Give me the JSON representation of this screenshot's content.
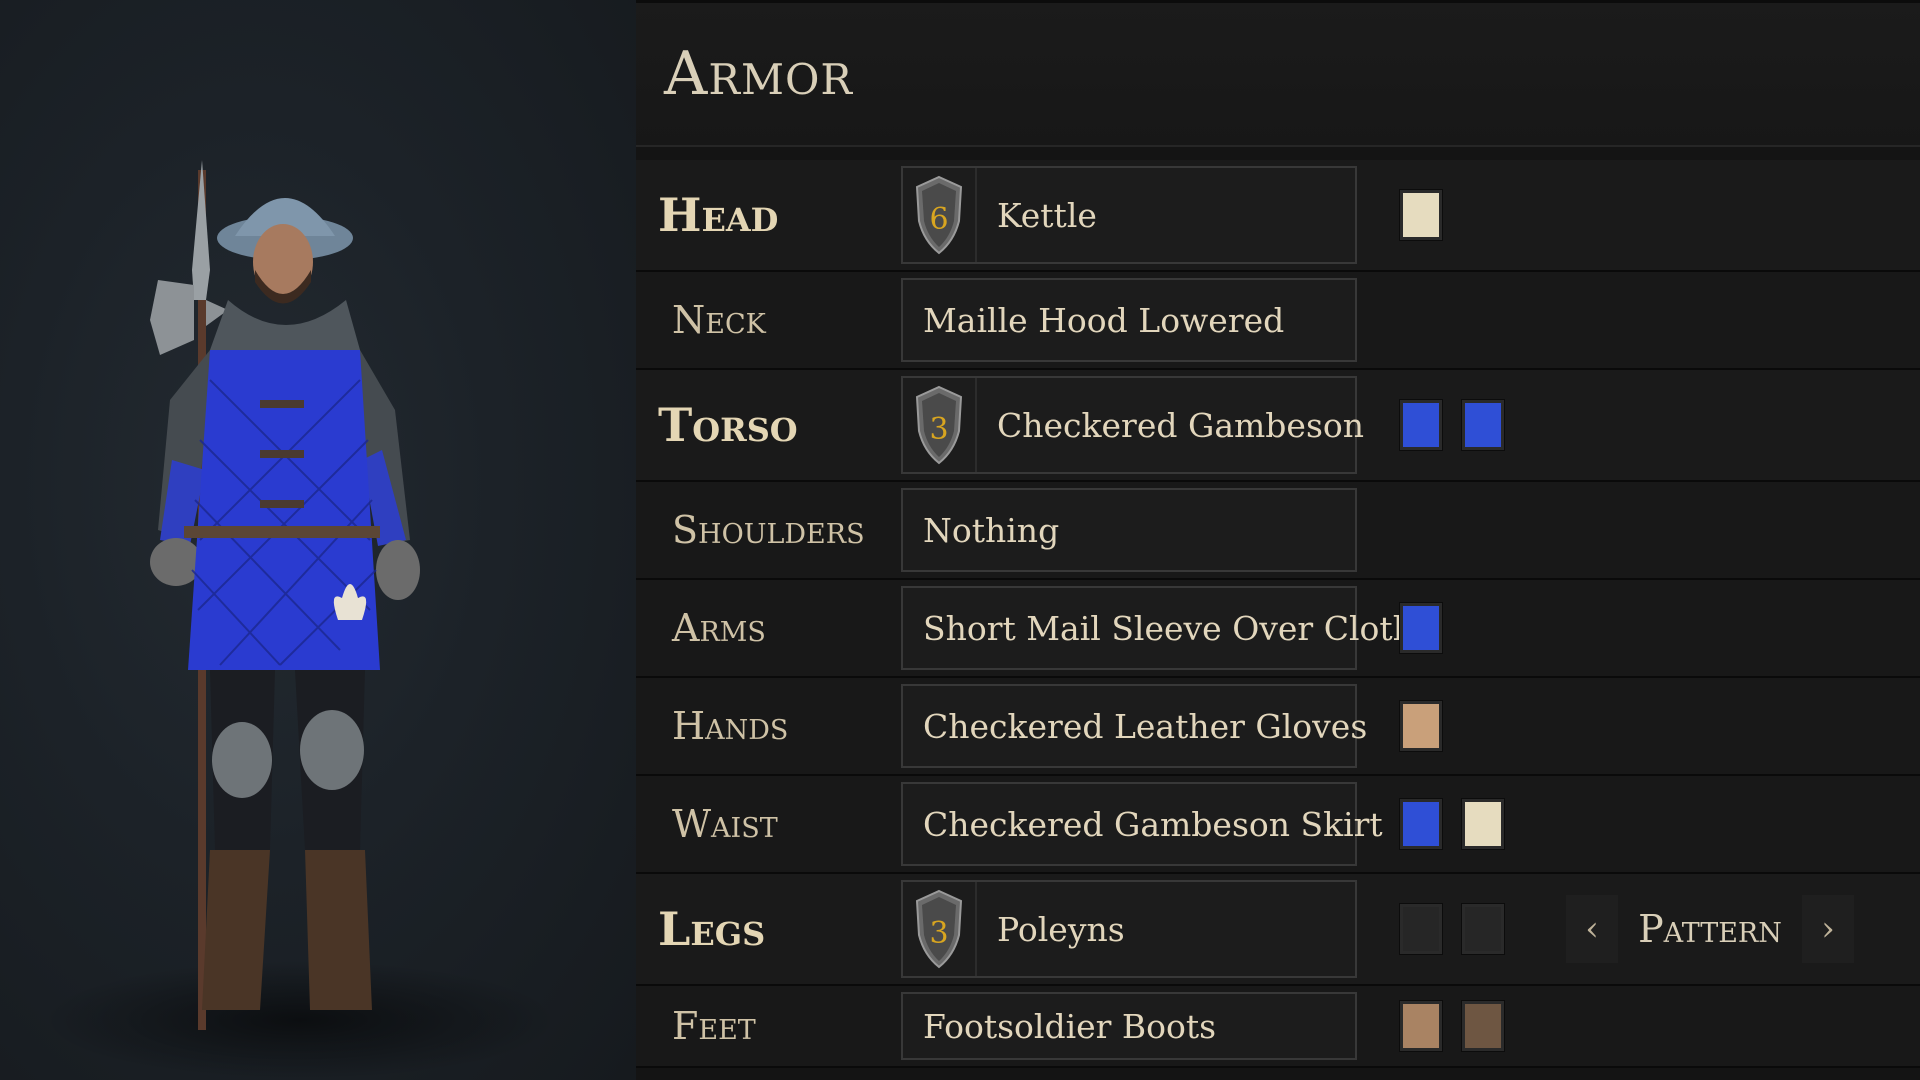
{
  "panel": {
    "title": "Armor"
  },
  "slots": [
    {
      "label": "Head",
      "item": "Kettle",
      "tier": "6",
      "colors": [
        "#e6dcbf"
      ]
    },
    {
      "label": "Neck",
      "item": "Maille Hood Lowered",
      "colors": []
    },
    {
      "label": "Torso",
      "item": "Checkered Gambeson",
      "tier": "3",
      "colors": [
        "#2f4fd6",
        "#2f4fd6"
      ]
    },
    {
      "label": "Shoulders",
      "item": "Nothing",
      "colors": []
    },
    {
      "label": "Arms",
      "item": "Short Mail Sleeve Over Cloth",
      "colors": [
        "#2f4fd6"
      ]
    },
    {
      "label": "Hands",
      "item": "Checkered Leather Gloves",
      "colors": [
        "#c9a07a"
      ]
    },
    {
      "label": "Waist",
      "item": "Checkered Gambeson Skirt",
      "colors": [
        "#2f4fd6",
        "#e6dcbf"
      ]
    },
    {
      "label": "Legs",
      "item": "Poleyns",
      "tier": "3",
      "colors": [
        "#262626",
        "#262626"
      ],
      "pattern": "Pattern"
    },
    {
      "label": "Feet",
      "item": "Footsoldier Boots",
      "colors": [
        "#a98363",
        "#6e5642"
      ]
    }
  ],
  "icons": {
    "tier_badge": "shield-icon",
    "pattern_prev": "chevron-left-icon",
    "pattern_next": "chevron-right-icon"
  }
}
